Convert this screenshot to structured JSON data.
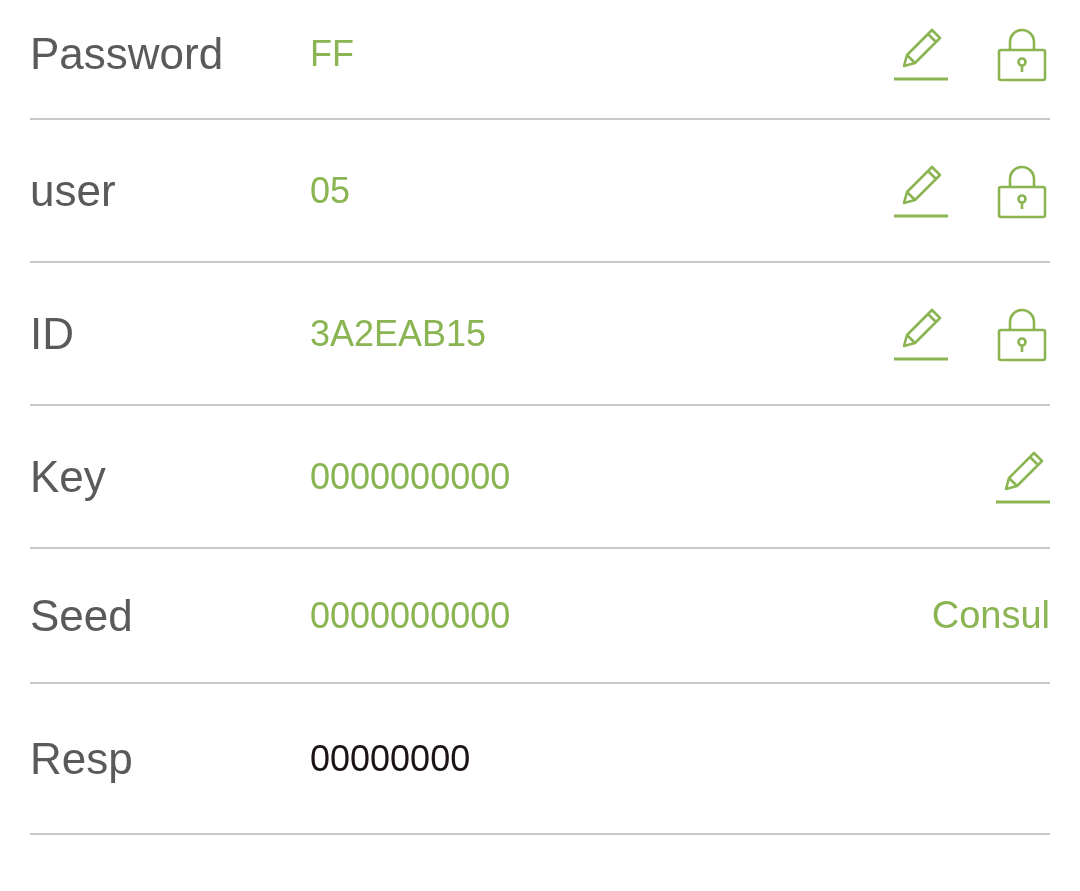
{
  "rows": [
    {
      "label": "Password",
      "value": "FF",
      "active": true,
      "edit_icon": true,
      "lock_icon": true
    },
    {
      "label": "user",
      "value": "05",
      "active": true,
      "edit_icon": true,
      "lock_icon": true
    },
    {
      "label": "ID",
      "value": "3A2EAB15",
      "active": true,
      "edit_icon": true,
      "lock_icon": true
    },
    {
      "label": "Key",
      "value": "0000000000",
      "active": true,
      "edit_icon": true,
      "lock_icon": false
    },
    {
      "label": "Seed",
      "value": "0000000000",
      "active": true,
      "edit_icon": false,
      "lock_icon": false,
      "action": "Consul"
    },
    {
      "label": "Resp",
      "value": "00000000",
      "active": false,
      "edit_icon": false,
      "lock_icon": false
    }
  ]
}
